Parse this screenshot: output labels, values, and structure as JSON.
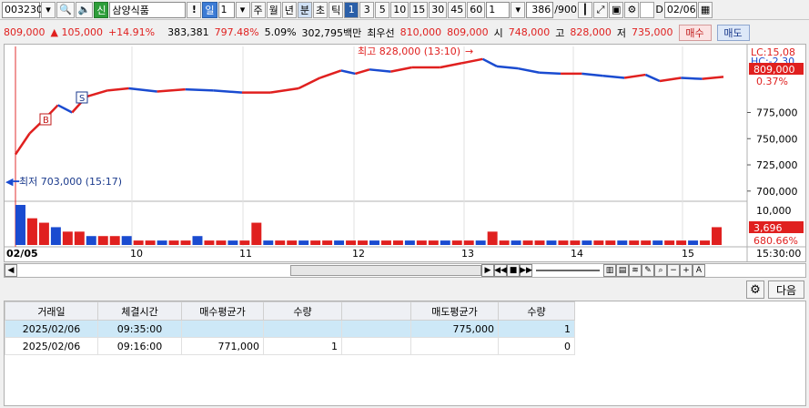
{
  "toolbar": {
    "code": "003230",
    "kind_badge": "신",
    "name": "삼양식품",
    "alert": "!",
    "period_selected": "일",
    "period_value": "1",
    "periods": [
      "주",
      "월",
      "년",
      "분",
      "초",
      "틱"
    ],
    "minutes": [
      "1",
      "3",
      "5",
      "10",
      "15",
      "30",
      "45",
      "60"
    ],
    "unit_value": "1",
    "count": "386",
    "count_total": "/900",
    "date": "02/06",
    "d_label": "D"
  },
  "quote": {
    "price": "809,000",
    "change": "▲ 105,000",
    "change_rate": "+14.91%",
    "volume": "383,381",
    "volume_rate": "797.48%",
    "turnover": "5.09%",
    "amount": "302,795백만",
    "best_label": "최우선",
    "best_ask": "810,000",
    "best_bid": "809,000",
    "open_label": "시",
    "open": "748,000",
    "high_label": "고",
    "high": "828,000",
    "low_label": "저",
    "low": "735,000",
    "buy_button": "매수",
    "sell_button": "매도"
  },
  "chart": {
    "high_marker": "최고 828,000 (13:10)",
    "low_marker": "최저 703,000 (15:17)",
    "lc_label": "LC:15,08",
    "hc_label": "HC:-2.30",
    "current_price": "809,000",
    "current_rate": "0.37%",
    "volume_current": "3,696",
    "volume_rate": "680.66%",
    "volume_axis_top": "10,000",
    "x_labels": [
      "02/05",
      "10",
      "11",
      "12",
      "13",
      "14",
      "15",
      "15:30:00"
    ],
    "marker_b": "B",
    "marker_s": "S"
  },
  "chart_data": {
    "type": "line",
    "y_axis_labels": [
      "775,000",
      "750,000",
      "725,000",
      "700,000"
    ],
    "y_ticks": [
      775000,
      750000,
      725000,
      700000
    ],
    "ylim": [
      692000,
      838000
    ],
    "high": 828000,
    "low": 703000,
    "current": 809000,
    "price_points": [
      [
        0,
        735000
      ],
      [
        0.02,
        755000
      ],
      [
        0.04,
        768000
      ],
      [
        0.06,
        782000
      ],
      [
        0.08,
        775000
      ],
      [
        0.1,
        790000
      ],
      [
        0.13,
        796000
      ],
      [
        0.16,
        798000
      ],
      [
        0.2,
        795000
      ],
      [
        0.24,
        797000
      ],
      [
        0.28,
        796000
      ],
      [
        0.32,
        794000
      ],
      [
        0.36,
        794000
      ],
      [
        0.4,
        798000
      ],
      [
        0.43,
        808000
      ],
      [
        0.46,
        815000
      ],
      [
        0.48,
        812000
      ],
      [
        0.5,
        816000
      ],
      [
        0.53,
        814000
      ],
      [
        0.56,
        818000
      ],
      [
        0.6,
        818000
      ],
      [
        0.63,
        822000
      ],
      [
        0.66,
        826000
      ],
      [
        0.68,
        819000
      ],
      [
        0.71,
        817000
      ],
      [
        0.74,
        813000
      ],
      [
        0.77,
        812000
      ],
      [
        0.8,
        812000
      ],
      [
        0.83,
        810000
      ],
      [
        0.86,
        808000
      ],
      [
        0.89,
        811000
      ],
      [
        0.91,
        805000
      ],
      [
        0.94,
        808000
      ],
      [
        0.97,
        807000
      ],
      [
        1.0,
        809000
      ]
    ],
    "volume_values": [
      9,
      6,
      5,
      4,
      3,
      3,
      2,
      2,
      2,
      2,
      1,
      1,
      1,
      1,
      1,
      2,
      1,
      1,
      1,
      1,
      5,
      1,
      1,
      1,
      1,
      1,
      1,
      1,
      1,
      1,
      1,
      1,
      1,
      1,
      1,
      1,
      1,
      1,
      1,
      1,
      3,
      1,
      1,
      1,
      1,
      1,
      1,
      1,
      1,
      1,
      1,
      1,
      1,
      1,
      1,
      1,
      1,
      1,
      1,
      4
    ],
    "ylim_volume": [
      0,
      11000
    ]
  },
  "table": {
    "headers": [
      "거래일",
      "체결시간",
      "매수평균가",
      "수량",
      "",
      "매도평균가",
      "수량"
    ],
    "rows": [
      [
        "2025/02/06",
        "09:35:00",
        "",
        "",
        "",
        "775,000",
        "1"
      ],
      [
        "2025/02/06",
        "09:16:00",
        "771,000",
        "1",
        "",
        "",
        "0"
      ]
    ],
    "next_button": "다음"
  },
  "colors": {
    "up": "#e0201f",
    "down": "#1a4bd0",
    "selected_tab": "#3c7bd5"
  }
}
